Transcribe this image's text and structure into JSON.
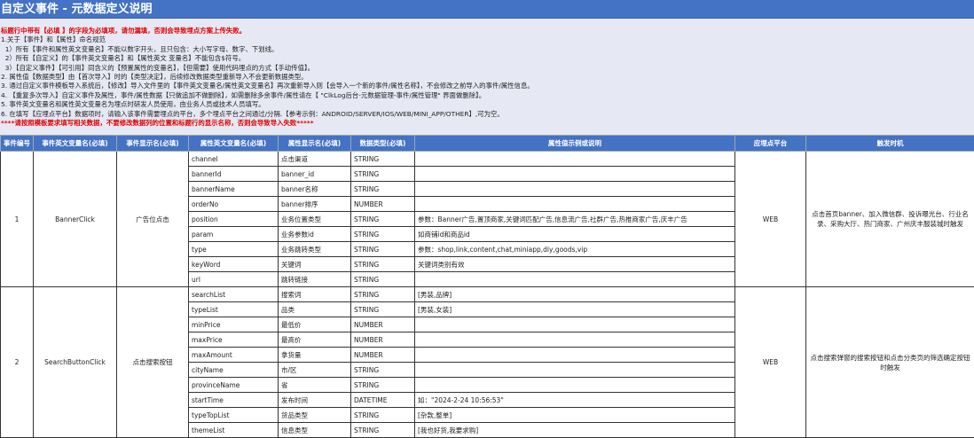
{
  "title": "自定义事件 - 元数据定义说明",
  "notes": [
    {
      "text": "标题行中带有【必填 】的字段为必填项，请勿漏填，否则会导致埋点方案上传失败。",
      "red": true
    },
    {
      "text": "1.关于【事件】和【属性】命名规范",
      "red": false
    },
    {
      "text": "  1）所有【事件和属性英文变量名】不能以数字开头，且只包含：大小写字母、数字、下划线。",
      "red": false
    },
    {
      "text": "  2）所有【自定义】的【事件英文变量名】和【属性英文 变量名】不能包含$符号。",
      "red": false
    },
    {
      "text": "  3）【自定义事件】【可引用】同含义的【预置属性的变量名】，【但需要】使用代码埋点的方式【手动传值】。",
      "red": false
    },
    {
      "text": "2. 属性值【数据类型】由【首次导入】时的【类型决定】，后续修改数据类型重新导入不会更新数据类型。",
      "red": false
    },
    {
      "text": "3. 通过自定义事件模板导入系统后，【修改】导入文件里的【事件英文变量名/属性英文变量名】再次重新导入则【会导入一个新的事件/属性名称】，不会修改之前导入的事件/属性信息。",
      "red": false
    },
    {
      "text": "4. 【重复多次导入】自定义事件及属性，事件/属性数据【只做追加不做删除】，如需删除多余事件/属性请在【 \"ClkLog后台-元数据管理-事件/属性管理\" 界面做删除】。",
      "red": false
    },
    {
      "text": "5. 事件英文变量名和属性英文变量名为埋点时研发人员使用，由业务人员或技术人员填写。",
      "red": false
    },
    {
      "text": "6. 在填写【应埋点平台】数据项时，请输入该事件需要埋点的平台，多个埋点平台之间通过/分隔.【参考示例：ANDROID/SERVER/IOS/WEB/MINI_APP/OTHER】,可为空。",
      "red": false
    },
    {
      "text": "****请按照模板要求填写相关数据，不要修改数据列的位置和标题行的显示名称，否则会导致导入失败*****",
      "red": true
    }
  ],
  "headers": [
    "事件编号",
    "事件英文变量名(必填)",
    "事件显示名(必填)",
    "属性英文变量名(必填)",
    "属性显示名(必填)",
    "数据类型(必填)",
    "属性值示例或说明",
    "应埋点平台",
    "触发时机"
  ],
  "events": [
    {
      "id": "1",
      "name": "BannerClick",
      "display": "广告位点击",
      "platform": "WEB",
      "trigger": "点击首页banner、加入微信群、投诉曝光台、行业名录、采购大厅、热门商家、广州庆丰服装城时触发",
      "props": [
        [
          "channel",
          "点击渠道",
          "STRING",
          ""
        ],
        [
          "bannerId",
          "banner_id",
          "STRING",
          ""
        ],
        [
          "bannerName",
          "banner名称",
          "STRING",
          ""
        ],
        [
          "orderNo",
          "banner排序",
          "NUMBER",
          ""
        ],
        [
          "position",
          "业务位置类型",
          "STRING",
          "参数：Banner广告,置顶商家,关键词匹配广告,信息流广告,社群广告,热推商家广告,庆丰广告"
        ],
        [
          "param",
          "业务参数id",
          "STRING",
          "如商铺id和商品id"
        ],
        [
          "type",
          "业务跳转类型",
          "STRING",
          "参数：shop,link,content,chat,miniapp,diy,goods,vip"
        ],
        [
          "keyWord",
          "关键词",
          "STRING",
          "关键词类别有效"
        ],
        [
          "url",
          "跳转链接",
          "STRING",
          ""
        ]
      ]
    },
    {
      "id": "2",
      "name": "SearchButtonClick",
      "display": "点击搜索按钮",
      "platform": "WEB",
      "trigger": "点击搜索弹窗的搜索按钮和点击分类页的筛选确定按钮时触发",
      "props": [
        [
          "searchList",
          "搜索词",
          "STRING",
          "[男装,品牌]"
        ],
        [
          "typeList",
          "品类",
          "STRING",
          "[男装,女装]"
        ],
        [
          "minPrice",
          "最低价",
          "NUMBER",
          ""
        ],
        [
          "maxPrice",
          "最高价",
          "NUMBER",
          ""
        ],
        [
          "maxAmount",
          "拿货量",
          "NUMBER",
          ""
        ],
        [
          "cityName",
          "市/区",
          "STRING",
          ""
        ],
        [
          "provinceName",
          "省",
          "STRING",
          ""
        ],
        [
          "startTime",
          "发布时间",
          "DATETIME",
          "如：\"2024-2-24  10:56:53\""
        ],
        [
          "typeTopList",
          "货品类型",
          "STRING",
          "[杂款,整单]"
        ],
        [
          "themeList",
          "信息类型",
          "STRING",
          "[我也好货,我要求购]"
        ]
      ]
    }
  ]
}
